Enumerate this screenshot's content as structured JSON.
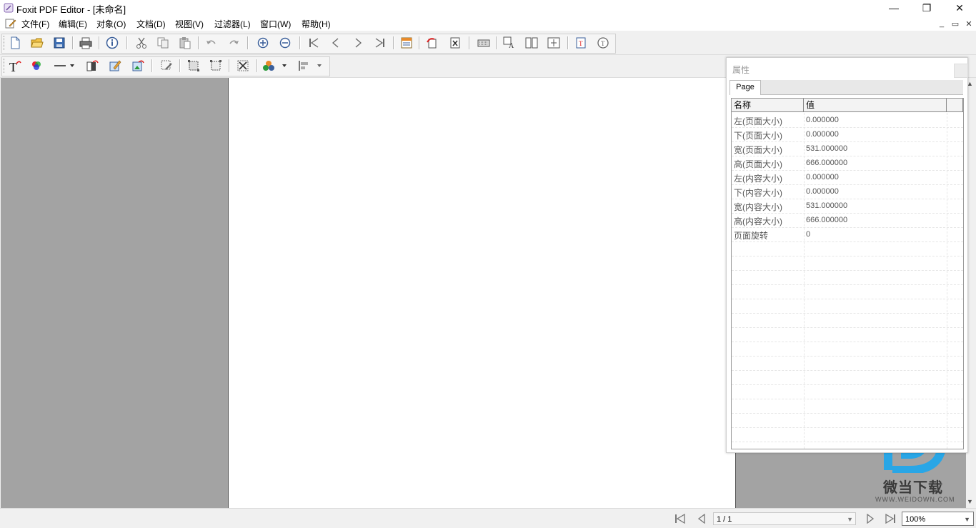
{
  "window": {
    "title": "Foxit PDF Editor - [未命名]",
    "minimize": "—",
    "maximize": "❐",
    "close": "✕",
    "mdi_minimize": "_",
    "mdi_restore": "▭",
    "mdi_close": "✕"
  },
  "menu": {
    "items": [
      {
        "label": "文件(F)"
      },
      {
        "label": "编辑(E)"
      },
      {
        "label": "对象(O)"
      },
      {
        "label": "文档(D)"
      },
      {
        "label": "视图(V)"
      },
      {
        "label": "过滤器(L)"
      },
      {
        "label": "窗口(W)"
      },
      {
        "label": "帮助(H)"
      }
    ]
  },
  "properties_panel": {
    "title": "属性",
    "tab": "Page",
    "col_name": "名称",
    "col_value": "值",
    "rows": [
      {
        "name": "左(页面大小)",
        "value": "0.000000"
      },
      {
        "name": "下(页面大小)",
        "value": "0.000000"
      },
      {
        "name": "宽(页面大小)",
        "value": "531.000000"
      },
      {
        "name": "高(页面大小)",
        "value": "666.000000"
      },
      {
        "name": "左(内容大小)",
        "value": "0.000000"
      },
      {
        "name": "下(内容大小)",
        "value": "0.000000"
      },
      {
        "name": "宽(内容大小)",
        "value": "531.000000"
      },
      {
        "name": "高(内容大小)",
        "value": "666.000000"
      },
      {
        "name": "页面旋转",
        "value": "0"
      }
    ]
  },
  "statusbar": {
    "page_indicator": "1 / 1",
    "zoom": "100%"
  },
  "watermark": {
    "text": "微当下载",
    "url": "WWW.WEIDOWN.COM"
  },
  "colors": {
    "workspace_gray": "#a3a3a3",
    "watermark_blue": "#29a6e6"
  }
}
